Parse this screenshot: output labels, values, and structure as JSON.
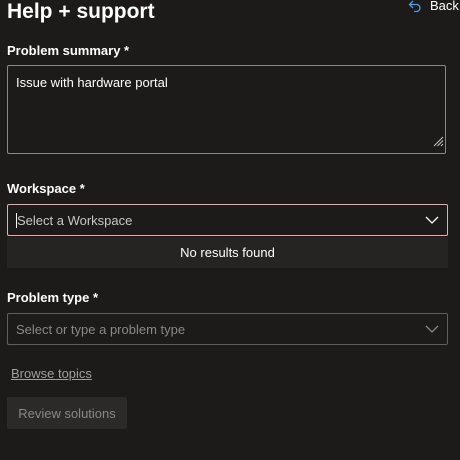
{
  "header": {
    "title": "Help + support",
    "back_label": "Back",
    "back_icon": "back-arrow-icon"
  },
  "problem_summary": {
    "label": "Problem summary *",
    "value": "Issue with hardware portal"
  },
  "workspace": {
    "label": "Workspace *",
    "placeholder": "Select a Workspace",
    "dropdown_message": "No results found"
  },
  "problem_type": {
    "label": "Problem type *",
    "placeholder": "Select or type a problem type"
  },
  "browse_topics": "Browse topics",
  "review_solutions": "Review solutions",
  "colors": {
    "background": "#1c1b1a",
    "focus_border": "#f1a7ac",
    "border": "#605e5c",
    "dropdown_bg": "#252423",
    "disabled_text": "#8a8886"
  }
}
